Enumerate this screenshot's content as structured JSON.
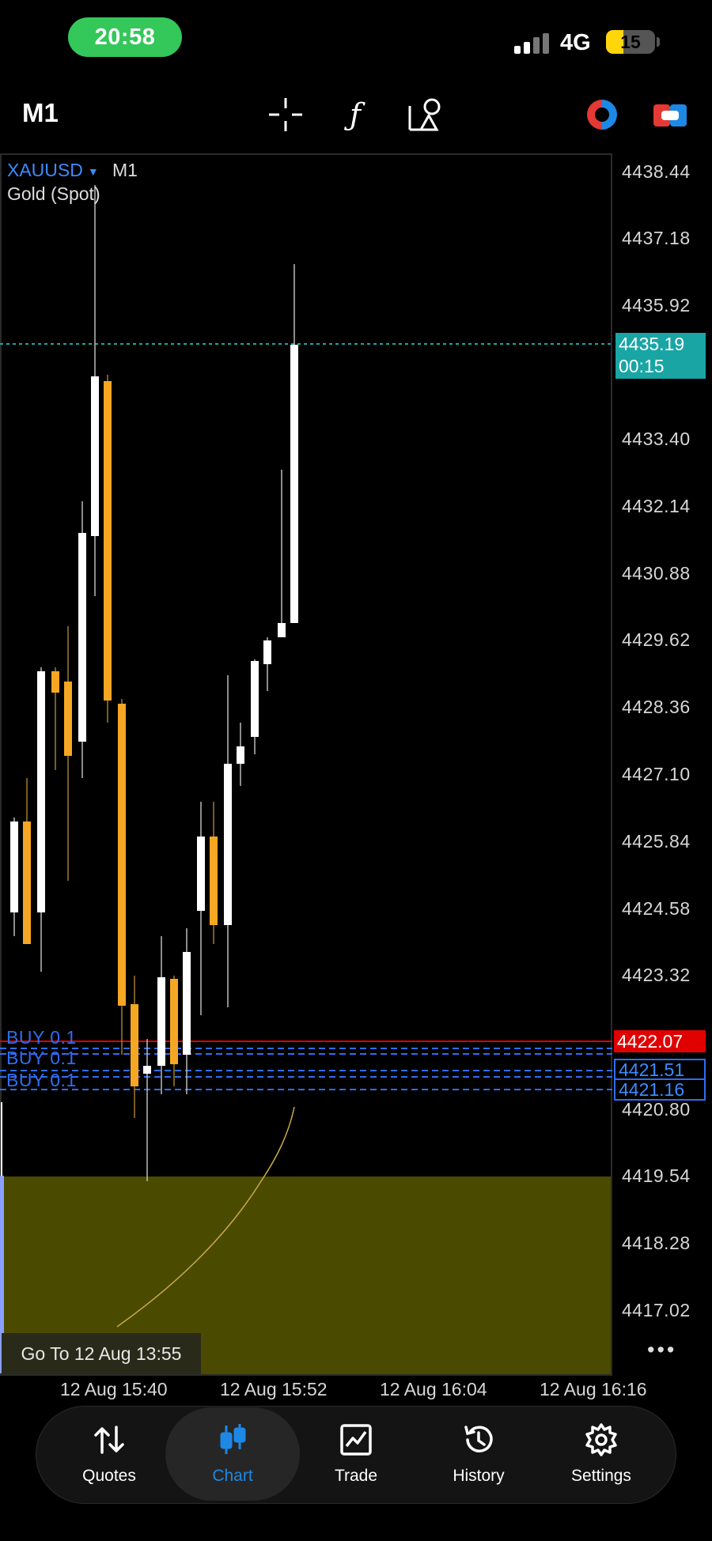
{
  "status_bar": {
    "time": "20:58",
    "network": "4G",
    "battery": "15"
  },
  "toolbar": {
    "timeframe": "M1",
    "icons": [
      "crosshair-icon",
      "indicators-icon",
      "objects-icon",
      "chart-type-icon",
      "trade-icon"
    ]
  },
  "chart": {
    "symbol": "XAUUSD",
    "timeframe": "M1",
    "description": "Gold (Spot)",
    "price_ticks": [
      "4438.44",
      "4437.18",
      "4435.92",
      "4433.40",
      "4432.14",
      "4430.88",
      "4429.62",
      "4428.36",
      "4427.10",
      "4425.84",
      "4424.58",
      "4423.32",
      "4420.80",
      "4419.54",
      "4418.28",
      "4417.02"
    ],
    "time_ticks": [
      "12 Aug 15:40",
      "12 Aug 15:52",
      "12 Aug 16:04",
      "12 Aug 16:16"
    ],
    "bid": {
      "price": "4435.19",
      "countdown": "00:15"
    },
    "order_prices": [
      "4422.07",
      "4421.51",
      "4421.16"
    ],
    "buy_labels": [
      "BUY 0.1",
      "BUY 0.1",
      "BUY 0.1"
    ],
    "goto_label": "Go To 12 Aug 13:55",
    "more_label": "•••",
    "colors": {
      "bull": "#ffffff",
      "bear": "#f5a623",
      "bid_line": "#1aa5a5",
      "order_line": "#2f6df2",
      "stop_line": "#e00000",
      "indicator_bg": "#4a4a00"
    }
  },
  "nav": {
    "items": [
      {
        "label": "Quotes",
        "icon": "quotes-icon"
      },
      {
        "label": "Chart",
        "icon": "chart-icon",
        "active": true
      },
      {
        "label": "Trade",
        "icon": "trade-chart-icon"
      },
      {
        "label": "History",
        "icon": "history-icon"
      },
      {
        "label": "Settings",
        "icon": "settings-icon"
      }
    ]
  }
}
